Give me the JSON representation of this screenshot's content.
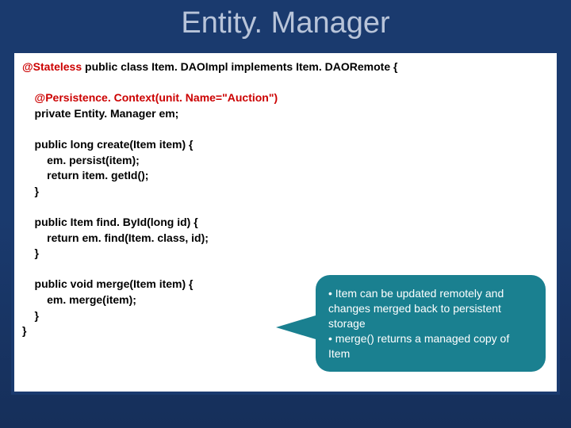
{
  "title": "Entity. Manager",
  "code": {
    "l1a": "@Stateless",
    "l1b": " public class Item. DAOImpl implements Item. DAORemote {",
    "blank1": " ",
    "l2": "    @Persistence. Context(unit. Name=\"Auction\")",
    "l3": "    private Entity. Manager em;",
    "blank2": " ",
    "l4": "    public long create(Item item) {",
    "l5": "        em. persist(item);",
    "l6": "        return item. getId();",
    "l7": "    }",
    "blank3": " ",
    "l8": "    public Item find. ById(long id) {",
    "l9": "        return em. find(Item. class, id);",
    "l10": "    }",
    "blank4": " ",
    "l11": "    public void merge(Item item) {",
    "l12": "        em. merge(item);",
    "l13": "    }",
    "l14": "}"
  },
  "callout": {
    "line1": "• Item can be updated remotely and changes merged back to persistent storage",
    "line2": "• merge() returns a managed copy of Item"
  }
}
